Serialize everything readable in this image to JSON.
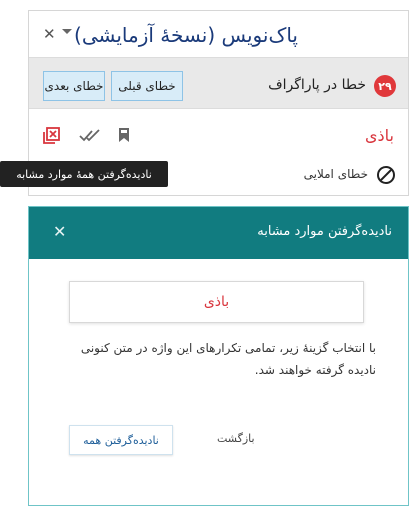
{
  "pane": {
    "title": "پاک‌نویس (نسخهٔ آزمایشی)",
    "error_count": "۲۹",
    "error_label": "خطا در پاراگراف",
    "prev_button": "خطای قبلی",
    "next_button": "خطای بعدی",
    "error_word": "باذی",
    "suggestion_label": "خطای املایی"
  },
  "tooltip": {
    "text": "نادیده‌گرفتن همهٔ موارد مشابه"
  },
  "dialog": {
    "title": "نادیده‌گرفتن موارد مشابه",
    "word": "باذی",
    "description": "با انتخاب گزینهٔ زیر، تمامی تکرارهای این واژه در متن کنونی نادیده گرفته خواهند شد.",
    "ignore_all_button": "نادیده‌گرفتن همه",
    "back_link": "بازگشت"
  },
  "colors": {
    "accent_teal": "#117c80",
    "error_red": "#d9363e",
    "title_blue": "#1a3a7a"
  }
}
